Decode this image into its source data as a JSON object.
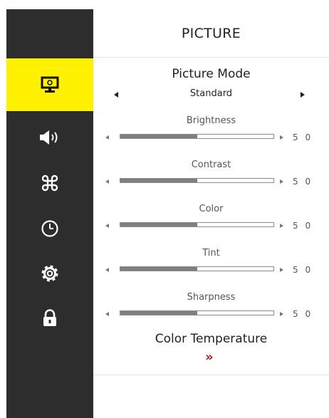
{
  "title": "PICTURE",
  "sidebar": {
    "items": [
      {
        "name": "picture",
        "icon": "monitor-icon",
        "active": true
      },
      {
        "name": "sound",
        "icon": "speaker-icon",
        "active": false
      },
      {
        "name": "channel",
        "icon": "command-icon",
        "active": false
      },
      {
        "name": "time",
        "icon": "clock-icon",
        "active": false
      },
      {
        "name": "setup",
        "icon": "gear-icon",
        "active": false
      },
      {
        "name": "lock",
        "icon": "lock-icon",
        "active": false
      }
    ],
    "active_color": "#fff100",
    "background_color": "#2d2d2d"
  },
  "picture_mode": {
    "label": "Picture Mode",
    "value": "Standard"
  },
  "settings": [
    {
      "label": "Brightness",
      "value": "5 0",
      "level": 0.5
    },
    {
      "label": "Contrast",
      "value": "5 0",
      "level": 0.5
    },
    {
      "label": "Color",
      "value": "5 0",
      "level": 0.5
    },
    {
      "label": "Tint",
      "value": "5 0",
      "level": 0.5
    },
    {
      "label": "Sharpness",
      "value": "5 0",
      "level": 0.5
    }
  ],
  "color_temperature": {
    "label": "Color Temperature",
    "chevron": "»",
    "chevron_color": "#b21c1c"
  }
}
